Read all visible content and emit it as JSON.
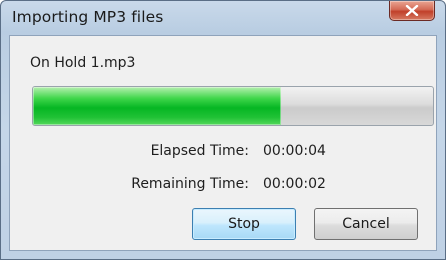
{
  "window": {
    "title": "Importing MP3 files",
    "close_symbol": "✕"
  },
  "dialog": {
    "filename": "On Hold 1.mp3",
    "progress_fraction": 0.62,
    "elapsed_label": "Elapsed Time:",
    "elapsed_value": "00:00:04",
    "remaining_label": "Remaining Time:",
    "remaining_value": "00:00:02",
    "stop_label": "Stop",
    "cancel_label": "Cancel"
  },
  "colors": {
    "progress_fill": "#06b623",
    "default_button_border": "#3c7fb1",
    "close_button": "#c0402a"
  }
}
